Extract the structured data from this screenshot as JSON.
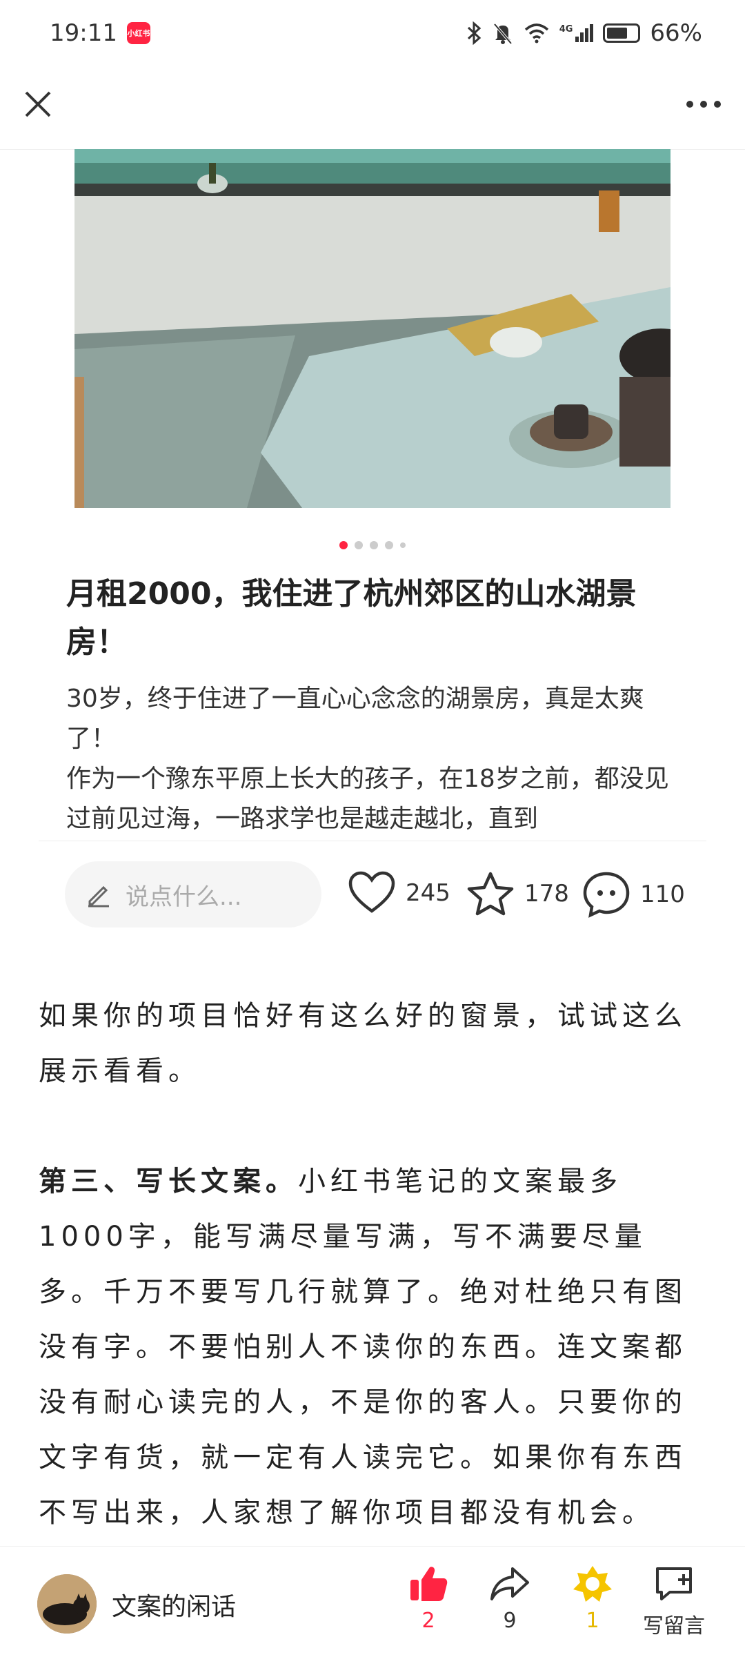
{
  "status_bar": {
    "time": "19:11",
    "app_badge": "小红书",
    "network": "4G",
    "battery": "66%"
  },
  "note": {
    "title": "月租2000，我住进了杭州郊区的山水湖景房！",
    "body": "30岁，终于住进了一直心心念念的湖景房，真是太爽了！\n作为一个豫东平原上长大的孩子，在18岁之前，都没见过前见过海，一路求学也是越走越北，直到",
    "carousel": {
      "total": 5,
      "active": 1
    }
  },
  "comment_bar": {
    "placeholder": "说点什么...",
    "likes": "245",
    "collects": "178",
    "comments": "110"
  },
  "article": {
    "paragraph1": "如果你的项目恰好有这么好的窗景，试试这么展示看看。",
    "paragraph2_bold": "第三、写长文案。",
    "paragraph2_rest": "小红书笔记的文案最多1000字，能写满尽量写满，写不满要尽量多。千万不要写几行就算了。绝对杜绝只有图没有字。不要怕别人不读你的东西。连文案都没有耐心读完的人，不是你的客人。只要你的文字有货，就一定有人读完它。如果你有东西不写出来，人家想了解你项目都没有机会。"
  },
  "bottom_bar": {
    "author": "文案的闲话",
    "like_count": "2",
    "share_count": "9",
    "reward_count": "1",
    "write_comment": "写留言"
  },
  "colors": {
    "brand_red": "#ff2442",
    "gold": "#f5c400"
  }
}
